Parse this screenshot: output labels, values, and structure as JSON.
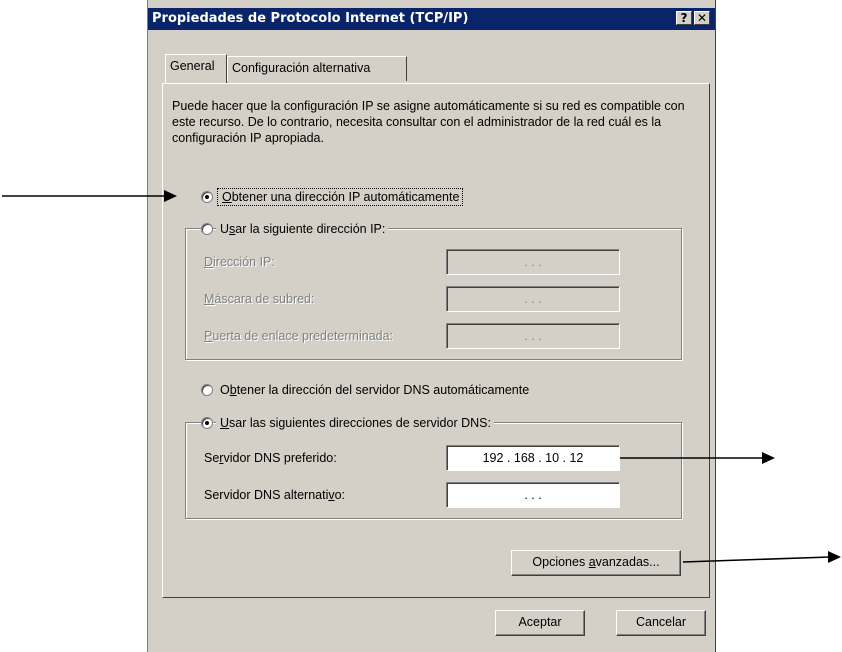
{
  "window": {
    "title": "Propiedades de Protocolo Internet (TCP/IP)",
    "help_glyph": "?",
    "close_glyph": "✕"
  },
  "tabs": [
    {
      "label": "General",
      "active": true
    },
    {
      "label": "Configuración alternativa",
      "active": false
    }
  ],
  "intro_text": "Puede hacer que la configuración IP se asigne automáticamente si su red es compatible con este recurso. De lo contrario, necesita consultar con el administrador de la red cuál es la configuración IP apropiada.",
  "ip_mode": {
    "auto": {
      "pre": "",
      "key": "O",
      "post": "btener una dirección IP automáticamente",
      "checked": true
    },
    "manual": {
      "pre": "U",
      "key": "s",
      "post": "ar la siguiente dirección IP:",
      "checked": false
    }
  },
  "ip_fields": [
    {
      "pre": "",
      "key": "D",
      "post": "irección IP:",
      "value": ".        .        ."
    },
    {
      "pre": "",
      "key": "M",
      "post": "áscara de subred:",
      "value": ".        .        ."
    },
    {
      "pre": "",
      "key": "P",
      "post": "uerta de enlace predeterminada:",
      "value": ".        .        ."
    }
  ],
  "dns_mode": {
    "auto": {
      "pre": "O",
      "key": "b",
      "post": "tener la dirección del servidor DNS automáticamente",
      "checked": false
    },
    "manual": {
      "pre": "",
      "key": "U",
      "post": "sar las siguientes direcciones de servidor DNS:",
      "checked": true
    }
  },
  "dns_fields": [
    {
      "pre": "Se",
      "key": "r",
      "post": "vidor DNS preferido:",
      "value": "192 . 168 .  10  .  12"
    },
    {
      "pre": "Servidor DNS alternati",
      "key": "v",
      "post": "o:",
      "value": ".        .        ."
    }
  ],
  "buttons": {
    "advanced": {
      "pre": "Opciones ",
      "key": "a",
      "post": "vanzadas..."
    },
    "ok": "Aceptar",
    "cancel": "Cancelar"
  }
}
